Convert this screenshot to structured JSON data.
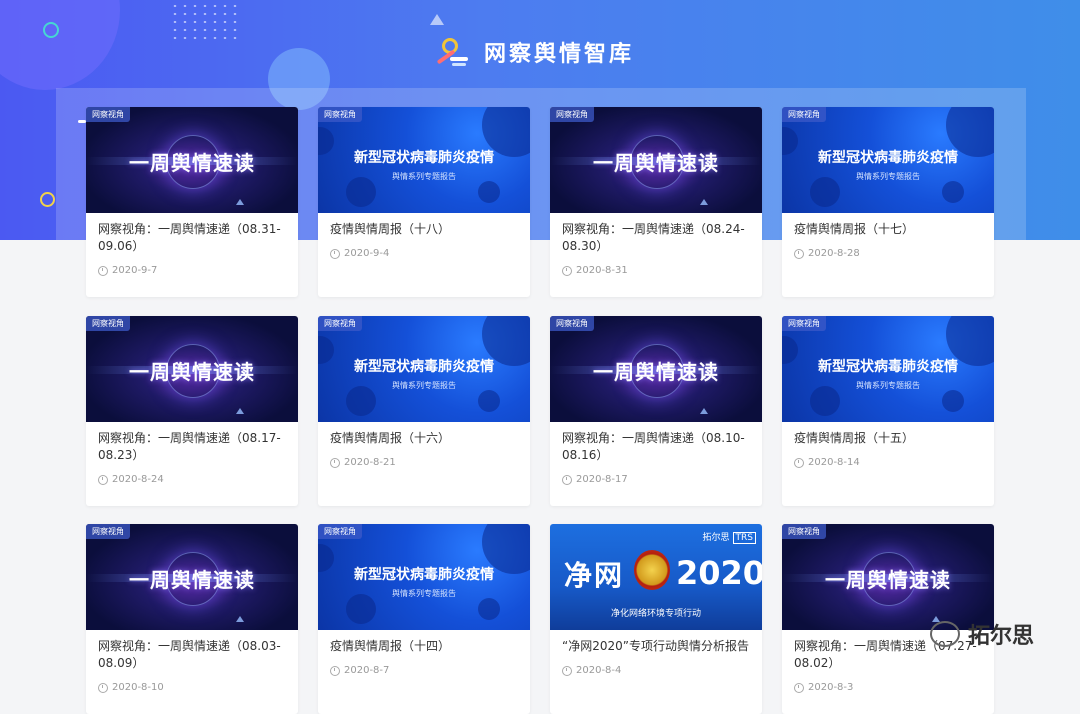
{
  "site_title": "网察舆情智库",
  "weekly_thumb": {
    "badge": "网察视角",
    "title": "一周舆情速读"
  },
  "covid_thumb": {
    "badge": "网察视角",
    "title": "新型冠状病毒肺炎疫情",
    "subtitle": "舆情系列专题报告"
  },
  "jingwang_thumb": {
    "brand": "拓尔思",
    "brand_tag": "TRS",
    "title": "净网",
    "year": "2020",
    "subtitle": "净化网络环境专项行动"
  },
  "cards": [
    {
      "type": "weekly",
      "title": "网察视角：一周舆情速递（08.31-09.06）",
      "date": "2020-9-7"
    },
    {
      "type": "covid",
      "title": "疫情舆情周报（十八）",
      "date": "2020-9-4"
    },
    {
      "type": "weekly",
      "title": "网察视角：一周舆情速递（08.24-08.30）",
      "date": "2020-8-31"
    },
    {
      "type": "covid",
      "title": "疫情舆情周报（十七）",
      "date": "2020-8-28"
    },
    {
      "type": "weekly",
      "title": "网察视角：一周舆情速递（08.17-08.23）",
      "date": "2020-8-24"
    },
    {
      "type": "covid",
      "title": "疫情舆情周报（十六）",
      "date": "2020-8-21"
    },
    {
      "type": "weekly",
      "title": "网察视角：一周舆情速递（08.10-08.16）",
      "date": "2020-8-17"
    },
    {
      "type": "covid",
      "title": "疫情舆情周报（十五）",
      "date": "2020-8-14"
    },
    {
      "type": "weekly",
      "title": "网察视角：一周舆情速递（08.03-08.09）",
      "date": "2020-8-10"
    },
    {
      "type": "covid",
      "title": "疫情舆情周报（十四）",
      "date": "2020-8-7"
    },
    {
      "type": "jingwang",
      "title": "“净网2020”专项行动舆情分析报告",
      "date": "2020-8-4"
    },
    {
      "type": "weekly",
      "title": "网察视角：一周舆情速递（07.27-08.02）",
      "date": "2020-8-3"
    }
  ],
  "watermark": {
    "text": "拓尔思"
  }
}
